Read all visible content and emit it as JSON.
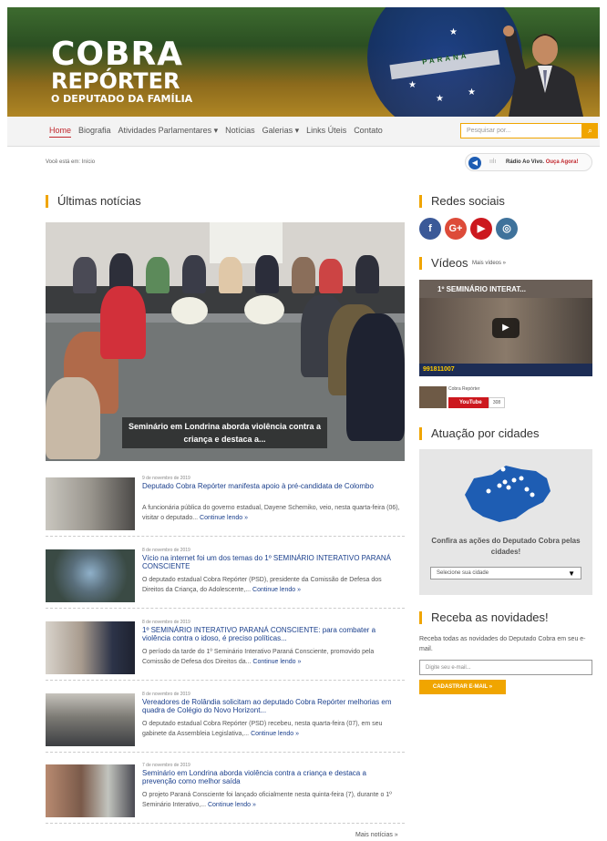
{
  "brand": {
    "line1": "COBRA",
    "line2": "REPÓRTER",
    "line3": "O DEPUTADO DA FAMÍLIA",
    "flag_text": "PARANÁ"
  },
  "nav": {
    "items": [
      "Home",
      "Biografia",
      "Atividades Parlamentares ▾",
      "Notícias",
      "Galerias ▾",
      "Links Úteis",
      "Contato"
    ],
    "search_placeholder": "Pesquisar por..."
  },
  "breadcrumb": "Você está em: Início",
  "radio": {
    "label": "Rádio Ao Vivo.",
    "cta": "Ouça Agora!"
  },
  "main": {
    "title": "Últimas notícias",
    "featured_caption": "Seminário em Londrina aborda violência contra a criança e destaca a...",
    "news": [
      {
        "date": "9 de novembro de 2019",
        "title": "Deputado Cobra Repórter manifesta apoio à pré-candidata de Colombo",
        "summary": "A funcionária pública do governo estadual, Dayene Schemiko, veio, nesta quarta-feira (06), visitar o deputado...",
        "more": "Continue lendo »"
      },
      {
        "date": "8 de novembro de 2019",
        "title": "Vício na internet foi um dos temas do 1º SEMINÁRIO INTERATIVO PARANÁ CONSCIENTE",
        "summary": "O deputado estadual Cobra Repórter (PSD), presidente da Comissão de Defesa dos Direitos da Criança, do Adolescente,...",
        "more": "Continue lendo »"
      },
      {
        "date": "8 de novembro de 2019",
        "title": "1º SEMINÁRIO INTERATIVO PARANÁ CONSCIENTE: para combater a violência contra o idoso, é preciso políticas...",
        "summary": "O período da tarde do 1º Seminário Interativo Paraná Consciente, promovido pela Comissão de Defesa dos Direitos da...",
        "more": "Continue lendo »"
      },
      {
        "date": "8 de novembro de 2019",
        "title": "Vereadores de Rolândia solicitam ao deputado Cobra Repórter melhorias em quadra de Colégio do Novo Horizont...",
        "summary": "O deputado estadual Cobra Repórter (PSD) recebeu, nesta quarta-feira (07), em seu gabinete da Assembleia Legislativa,...",
        "more": "Continue lendo »"
      },
      {
        "date": "7 de novembro de 2019",
        "title": "Seminário em Londrina aborda violência contra a criança e destaca a prevenção como melhor saída",
        "summary": "O projeto Paraná Consciente foi lançado oficialmente nesta quinta-feira (7), durante o 1º Seminário Interativo,...",
        "more": "Continue lendo »"
      }
    ],
    "more_news": "Mais notícias »"
  },
  "sidebar": {
    "social_title": "Redes sociais",
    "social": [
      {
        "icon": "facebook-icon",
        "glyph": "f",
        "color": "#3b5998"
      },
      {
        "icon": "google-plus-icon",
        "glyph": "G+",
        "color": "#dd4b39"
      },
      {
        "icon": "youtube-icon",
        "glyph": "▶",
        "color": "#cc181e"
      },
      {
        "icon": "instagram-icon",
        "glyph": "◎",
        "color": "#3f729b"
      }
    ],
    "videos_title": "Vídeos",
    "videos_more": "Mais vídeos »",
    "video_title": "1º SEMINÁRIO INTERAT...",
    "video_strip": "991811007",
    "channel_name": "Cobra Repórter",
    "youtube_label": "YouTube",
    "youtube_count": "308",
    "cities_title": "Atuação por cidades",
    "cities_cta": "Confira as ações do Deputado Cobra pelas cidades!",
    "cities_select": "Selecione sua cidade",
    "newsletter_title": "Receba as novidades!",
    "newsletter_text": "Receba todas as novidades do Deputado Cobra em seu e-mail.",
    "newsletter_placeholder": "Digite seu e-mail...",
    "newsletter_button": "CADASTRAR E-MAIL »"
  },
  "colors": {
    "accent": "#f0a500",
    "link": "#1a3f8c",
    "nav_active": "#c1272d"
  }
}
